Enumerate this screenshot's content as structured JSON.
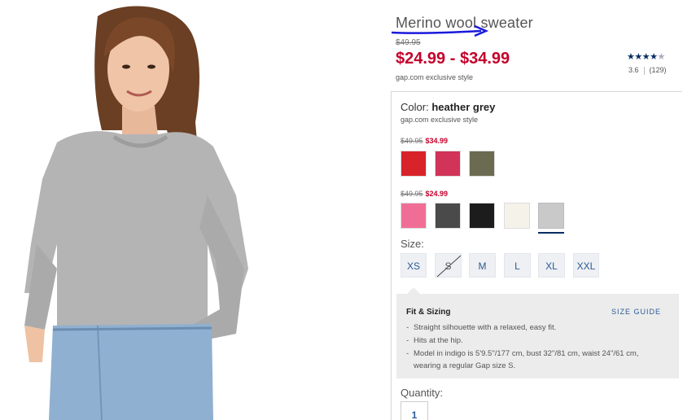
{
  "product": {
    "title": "Merino wool sweater",
    "old_price": "$49.95",
    "price_range": "$24.99 - $34.99",
    "exclusive": "gap.com exclusive style",
    "rating": "3.6",
    "review_count": "(129)",
    "stars_filled": "★★★★",
    "stars_empty": "★"
  },
  "color": {
    "label": "Color:",
    "value": "heather grey",
    "exclusive": "gap.com exclusive style",
    "tiers": [
      {
        "was": "$49.95",
        "now": "$34.99",
        "swatches": [
          {
            "name": "red",
            "color": "#d8232a"
          },
          {
            "name": "raspberry",
            "color": "#d23358"
          },
          {
            "name": "olive",
            "color": "#6b6b52"
          }
        ]
      },
      {
        "was": "$49.95",
        "now": "$24.99",
        "swatches": [
          {
            "name": "pink",
            "color": "#f06e95"
          },
          {
            "name": "charcoal",
            "color": "#4a4a4a"
          },
          {
            "name": "black",
            "color": "#1c1c1c"
          },
          {
            "name": "ivory",
            "color": "#f5f2ea"
          },
          {
            "name": "heather grey",
            "color": "#c9c9c9"
          }
        ]
      }
    ]
  },
  "size": {
    "label": "Size:",
    "options": [
      "XS",
      "S",
      "M",
      "L",
      "XL",
      "XXL"
    ]
  },
  "fit": {
    "title": "Fit & Sizing",
    "size_guide": "SIZE GUIDE",
    "items": [
      "Straight silhouette with a relaxed, easy fit.",
      "Hits at the hip.",
      "Model in indigo is 5'9.5\"/177 cm, bust 32\"/81 cm, waist 24\"/61 cm, wearing a regular Gap size S."
    ]
  },
  "quantity": {
    "label": "Quantity:",
    "value": "1"
  },
  "colors": {
    "price_red": "#c4002b",
    "link_blue": "#2b5a94",
    "annotation_blue": "#1a1adb"
  }
}
